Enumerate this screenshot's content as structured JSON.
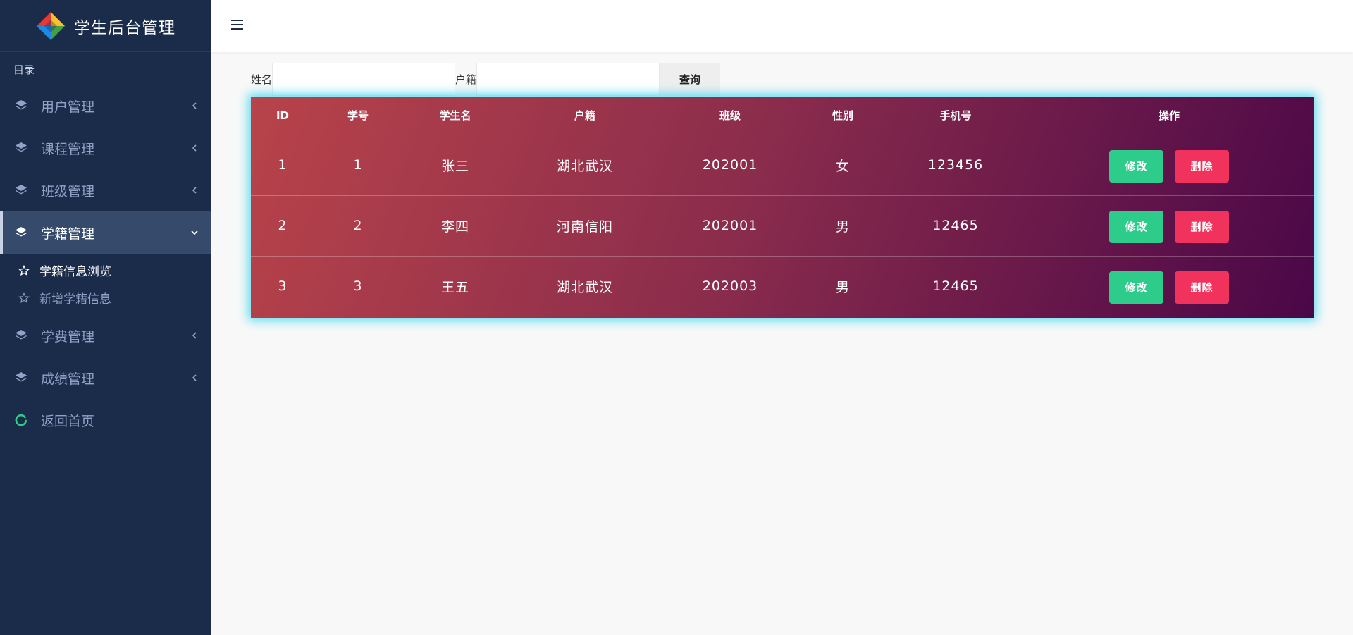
{
  "sidebar": {
    "brand_title": "学生后台管理",
    "section_label": "目录",
    "items": [
      {
        "label": "用户管理"
      },
      {
        "label": "课程管理"
      },
      {
        "label": "班级管理"
      },
      {
        "label": "学籍管理"
      },
      {
        "label": "学费管理"
      },
      {
        "label": "成绩管理"
      }
    ],
    "subitems": [
      {
        "label": "学籍信息浏览"
      },
      {
        "label": "新增学籍信息"
      }
    ],
    "home_label": "返回首页"
  },
  "search": {
    "name_label": "姓名",
    "name_value": "",
    "hukou_label": "户籍",
    "hukou_value": "",
    "query_button": "查询"
  },
  "table": {
    "headers": [
      "ID",
      "学号",
      "学生名",
      "户籍",
      "班级",
      "性别",
      "手机号",
      "操作"
    ],
    "rows": [
      [
        "1",
        "1",
        "张三",
        "湖北武汉",
        "202001",
        "女",
        "123456"
      ],
      [
        "2",
        "2",
        "李四",
        "河南信阳",
        "202001",
        "男",
        "12465"
      ],
      [
        "3",
        "3",
        "王五",
        "湖北武汉",
        "202003",
        "男",
        "12465"
      ]
    ],
    "edit_label": "修改",
    "delete_label": "删除"
  },
  "colors": {
    "sidebar_bg": "#1b2b4a",
    "edit_button": "#2ecc8a",
    "delete_button": "#f0325c",
    "table_glow": "#5fdcf0"
  }
}
